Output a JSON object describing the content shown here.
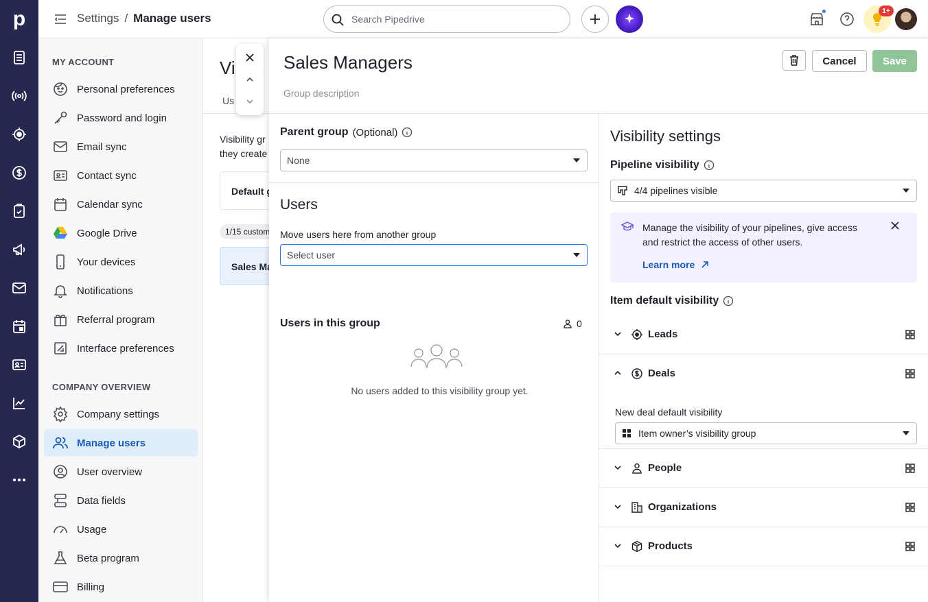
{
  "app": {
    "logo": "p"
  },
  "leftnav": {
    "icons": [
      "deals-list-icon",
      "broadcast-icon",
      "leads-target-icon",
      "dollar-icon",
      "tasks-icon",
      "megaphone-icon",
      "mail-icon",
      "calendar-icon",
      "contacts-card-icon",
      "chart-icon",
      "box-icon",
      "more-icon"
    ]
  },
  "topbar": {
    "breadcrumb_parent": "Settings",
    "breadcrumb_sep": "/",
    "breadcrumb_current": "Manage users",
    "search_placeholder": "Search Pipedrive",
    "notif_badge": "1+"
  },
  "sidebar": {
    "my_account_title": "MY ACCOUNT",
    "my_account_items": [
      {
        "label": "Personal preferences",
        "icon": "face-icon"
      },
      {
        "label": "Password and login",
        "icon": "key-icon"
      },
      {
        "label": "Email sync",
        "icon": "mail-icon"
      },
      {
        "label": "Contact sync",
        "icon": "contact-card-icon"
      },
      {
        "label": "Calendar sync",
        "icon": "calendar-icon"
      },
      {
        "label": "Google Drive",
        "icon": "google-drive-icon"
      },
      {
        "label": "Your devices",
        "icon": "phone-icon"
      },
      {
        "label": "Notifications",
        "icon": "bell-icon"
      },
      {
        "label": "Referral program",
        "icon": "gift-icon"
      },
      {
        "label": "Interface preferences",
        "icon": "interface-icon"
      }
    ],
    "company_title": "COMPANY OVERVIEW",
    "company_items": [
      {
        "label": "Company settings",
        "icon": "gear-icon"
      },
      {
        "label": "Manage users",
        "icon": "users-icon",
        "active": true
      },
      {
        "label": "User overview",
        "icon": "user-circle-icon"
      },
      {
        "label": "Data fields",
        "icon": "data-fields-icon"
      },
      {
        "label": "Usage",
        "icon": "gauge-icon"
      },
      {
        "label": "Beta program",
        "icon": "flask-icon"
      },
      {
        "label": "Billing",
        "icon": "credit-card-icon"
      }
    ]
  },
  "underlying": {
    "title": "Vi",
    "tab": "Us",
    "desc_line1": "Visibility gr",
    "desc_line2": "they create",
    "default_card": "Default g",
    "pill": "1/15 custom",
    "selected_card": "Sales Ma"
  },
  "panel": {
    "title": "Sales Managers",
    "description_placeholder": "Group description",
    "cancel_label": "Cancel",
    "save_label": "Save",
    "parent_group_label": "Parent group",
    "parent_group_optional": "(Optional)",
    "parent_group_value": "None",
    "users_heading": "Users",
    "move_users_label": "Move users here from another group",
    "select_user_placeholder": "Select user",
    "users_in_group_label": "Users in this group",
    "users_count": "0",
    "empty_message": "No users added to this visibility group yet.",
    "visibility_heading": "Visibility settings",
    "pipeline_visibility_label": "Pipeline visibility",
    "pipeline_visibility_value": "4/4 pipelines visible",
    "info_text": "Manage the visibility of your pipelines, give access and restrict the access of other users.",
    "learn_more": "Learn more",
    "item_default_label": "Item default visibility",
    "items": [
      {
        "label": "Leads",
        "icon": "leads-target-icon",
        "expanded": false
      },
      {
        "label": "Deals",
        "icon": "dollar-icon",
        "expanded": true
      },
      {
        "label": "People",
        "icon": "person-icon",
        "expanded": false
      },
      {
        "label": "Organizations",
        "icon": "building-icon",
        "expanded": false
      },
      {
        "label": "Products",
        "icon": "box-icon",
        "expanded": false
      }
    ],
    "deal_default_label": "New deal default visibility",
    "deal_default_value": "Item owner’s visibility group"
  },
  "colors": {
    "nav_bg": "#26284f",
    "accent_blue": "#317ae2",
    "active_bg": "#e0edfc",
    "save_green": "#8fc597",
    "info_bg": "#f2f1fd"
  }
}
